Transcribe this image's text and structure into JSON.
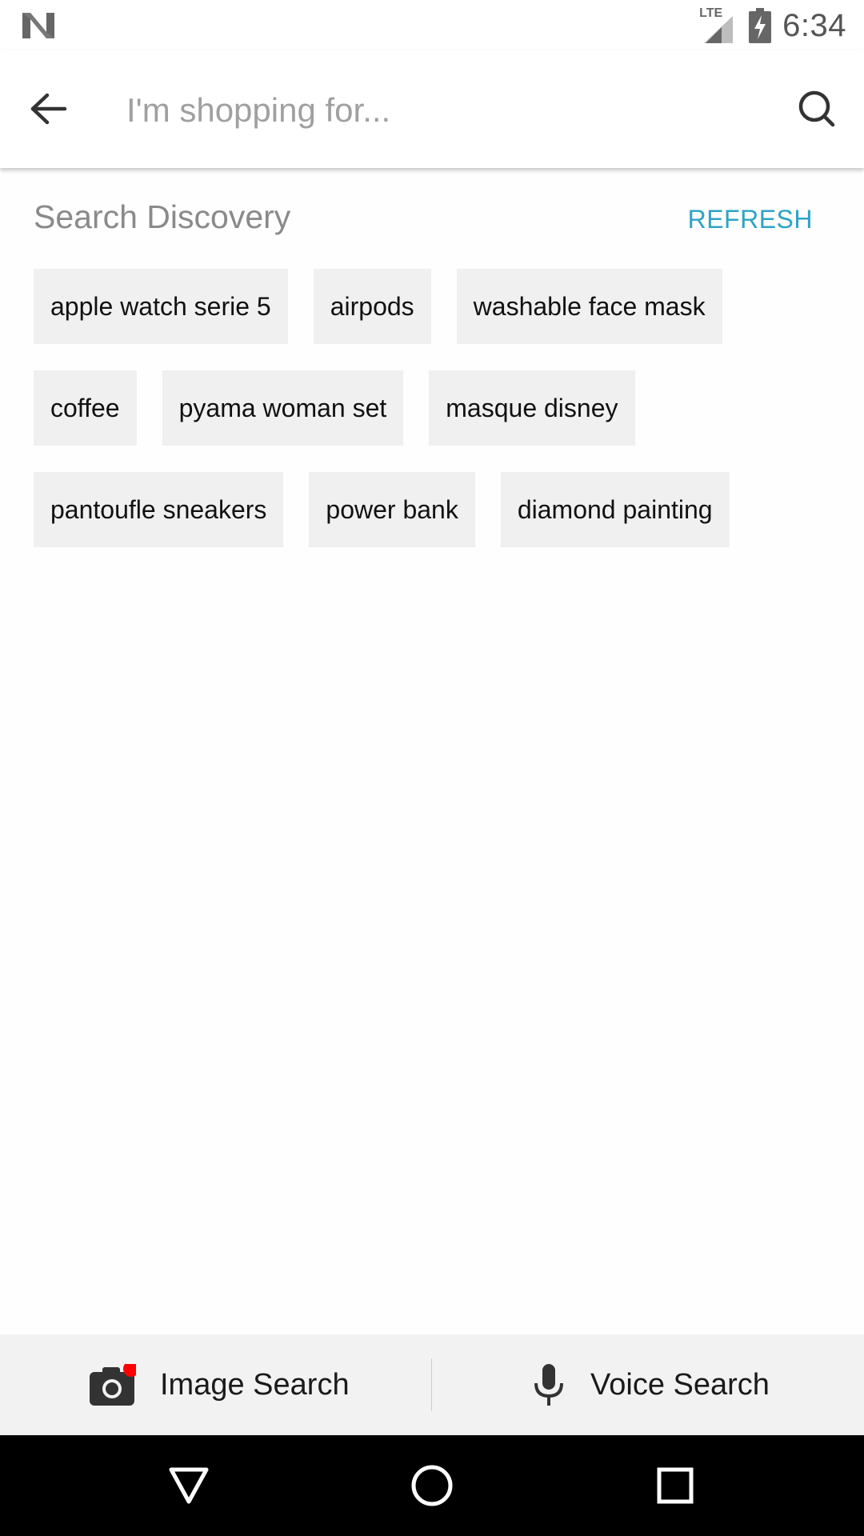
{
  "status_bar": {
    "time": "6:34",
    "network_label": "LTE",
    "icons": [
      "notification-n-icon",
      "lte-signal-icon",
      "battery-charging-icon"
    ]
  },
  "app_bar": {
    "search_placeholder": "I'm shopping for...",
    "icons": [
      "back-arrow-icon",
      "search-icon"
    ]
  },
  "discovery": {
    "title": "Search Discovery",
    "refresh_label": "REFRESH",
    "rows": [
      [
        "apple watch serie 5",
        "airpods",
        "washable face mask"
      ],
      [
        "coffee",
        "pyama woman set",
        "masque disney"
      ],
      [
        "pantoufle sneakers",
        "power bank",
        "diamond painting"
      ]
    ]
  },
  "bottom_bar": {
    "image_search_label": "Image Search",
    "voice_search_label": "Voice Search",
    "icons": [
      "camera-icon",
      "microphone-icon"
    ]
  },
  "colors": {
    "accent": "#2ea3c7",
    "chip_bg": "#f0f0f0",
    "badge_red": "#ff0000"
  }
}
